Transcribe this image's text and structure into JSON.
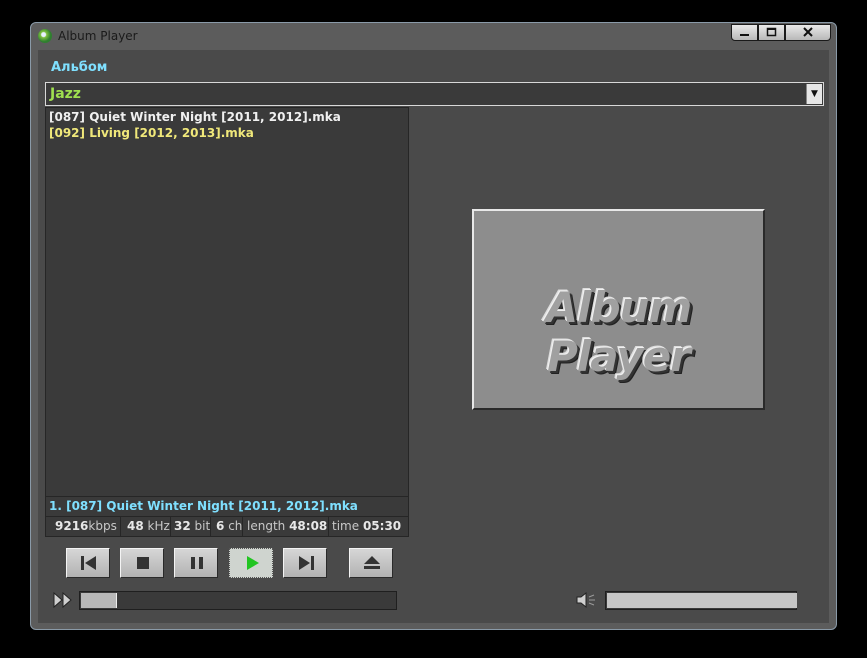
{
  "window": {
    "title": "Album Player",
    "buttons": {
      "minimize": "—",
      "maximize": "□",
      "close": "✕"
    }
  },
  "album": {
    "label": "Альбом",
    "selected": "Jazz"
  },
  "playlist": [
    {
      "text": "[087] Quiet Winter Night [2011, 2012].mka",
      "color": "#f0f0f0"
    },
    {
      "text": "[092] Living [2012, 2013].mka",
      "color": "#f0e87a"
    }
  ],
  "now_playing": "1.  [087] Quiet Winter Night [2011, 2012].mka",
  "info": {
    "bitrate": "9216",
    "bitrate_unit": "kbps",
    "rate": "48",
    "rate_unit": "kHz",
    "bits": "32",
    "bits_unit": "bit",
    "channels": "6",
    "channels_unit": "ch",
    "length_label": "length",
    "length": "48:08",
    "time_label": "time",
    "time": "05:30"
  },
  "cover_text": "Album Player",
  "controls": [
    "skip-back-icon",
    "stop-icon",
    "pause-icon",
    "play-icon",
    "skip-forward-icon",
    "eject-icon"
  ],
  "seek_progress": 0.11,
  "volume_level": 1.0,
  "colors": {
    "accent": "#7fe0ff",
    "album_value": "#9fe04f",
    "play_icon": "#22c522"
  }
}
